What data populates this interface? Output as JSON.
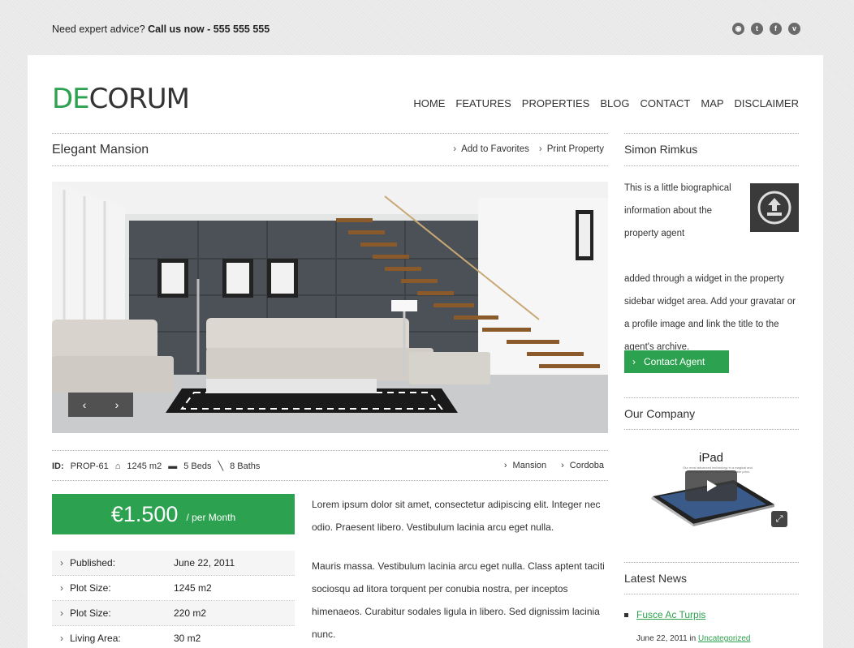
{
  "topbar": {
    "advice_prefix": "Need expert advice?",
    "call_text": "Call us now - 555 555 555",
    "social_icons": [
      "rss-icon",
      "twitter-icon",
      "facebook-icon",
      "vimeo-icon"
    ]
  },
  "logo": {
    "part1": "DE",
    "part2": "CORUM"
  },
  "nav": [
    "HOME",
    "FEATURES",
    "PROPERTIES",
    "BLOG",
    "CONTACT",
    "MAP",
    "DISCLAIMER"
  ],
  "property": {
    "title": "Elegant Mansion",
    "actions": [
      "Add to Favorites",
      "Print Property"
    ],
    "id_label": "ID:",
    "id_value": "PROP-61",
    "area": "1245 m2",
    "beds": "5 Beds",
    "baths": "8 Baths",
    "type": "Mansion",
    "location": "Cordoba",
    "price": "€1.500",
    "price_period": "/ per Month",
    "details": [
      {
        "label": "Published:",
        "value": "June 22, 2011"
      },
      {
        "label": "Plot Size:",
        "value": "1245 m2"
      },
      {
        "label": "Plot Size:",
        "value": "220 m2"
      },
      {
        "label": "Living Area:",
        "value": "30 m2"
      }
    ],
    "description": [
      "Lorem ipsum dolor sit amet, consectetur adipiscing elit. Integer nec odio. Praesent libero. Vestibulum lacinia arcu eget nulla.",
      "Mauris massa. Vestibulum lacinia arcu eget nulla. Class aptent taciti sociosqu ad litora torquent per conubia nostra, per inceptos himenaeos. Curabitur sodales ligula in libero. Sed dignissim lacinia nunc."
    ]
  },
  "sidebar": {
    "agent_name": "Simon Rimkus",
    "bio_narrow": "This is a little biographical information about the property agent",
    "bio_wide": "added through a widget in the property sidebar widget area. Add your gravatar or a profile image and link the title to the agent's archive.",
    "contact_button": "Contact Agent",
    "company_title": "Our Company",
    "ipad_title": "iPad",
    "ipad_caption": "Our most advanced technology in a magical and revolutionary device at an unbelievable price.",
    "news_title": "Latest News",
    "news": [
      {
        "title": "Fusce Ac Turpis",
        "date": "June 22, 2011",
        "in": "in",
        "category": "Uncategorized"
      }
    ]
  },
  "colors": {
    "accent": "#2ca14f"
  }
}
